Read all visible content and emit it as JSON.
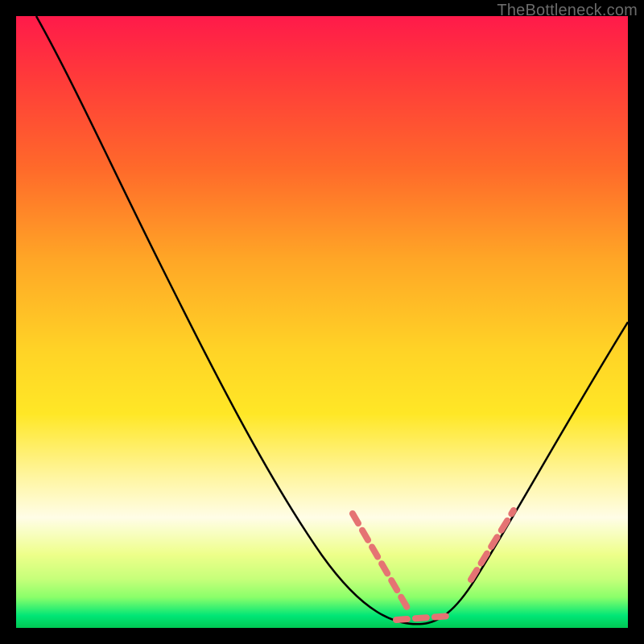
{
  "watermark": "TheBottleneck.com",
  "colors": {
    "frame": "#000000",
    "curve": "#000000",
    "tick_marker": "#e57373",
    "gradient_top": "#ff1a4a",
    "gradient_bottom": "#00c853"
  },
  "chart_data": {
    "type": "line",
    "title": "",
    "xlabel": "",
    "ylabel": "",
    "xlim": [
      0,
      100
    ],
    "ylim": [
      0,
      100
    ],
    "grid": false,
    "legend": false,
    "series": [
      {
        "name": "bottleneck-curve",
        "x": [
          0,
          5,
          10,
          15,
          20,
          25,
          30,
          35,
          40,
          45,
          50,
          55,
          60,
          63,
          66,
          70,
          75,
          80,
          85,
          90,
          95,
          100
        ],
        "values": [
          100,
          98,
          94,
          89,
          83,
          76,
          68,
          59,
          50,
          40,
          29,
          18,
          9,
          3,
          0,
          2,
          8,
          16,
          25,
          34,
          42,
          50
        ]
      }
    ],
    "annotations": [
      {
        "name": "salmon-dash-left",
        "shape": "dashed-segment",
        "start": {
          "x": 55,
          "y": 18
        },
        "end": {
          "x": 63,
          "y": 3
        }
      },
      {
        "name": "salmon-dash-bottom",
        "shape": "dashed-segment",
        "start": {
          "x": 63,
          "y": 3
        },
        "end": {
          "x": 70,
          "y": 2
        }
      },
      {
        "name": "salmon-dash-right",
        "shape": "dashed-segment",
        "start": {
          "x": 75,
          "y": 8
        },
        "end": {
          "x": 81,
          "y": 17
        }
      }
    ]
  }
}
